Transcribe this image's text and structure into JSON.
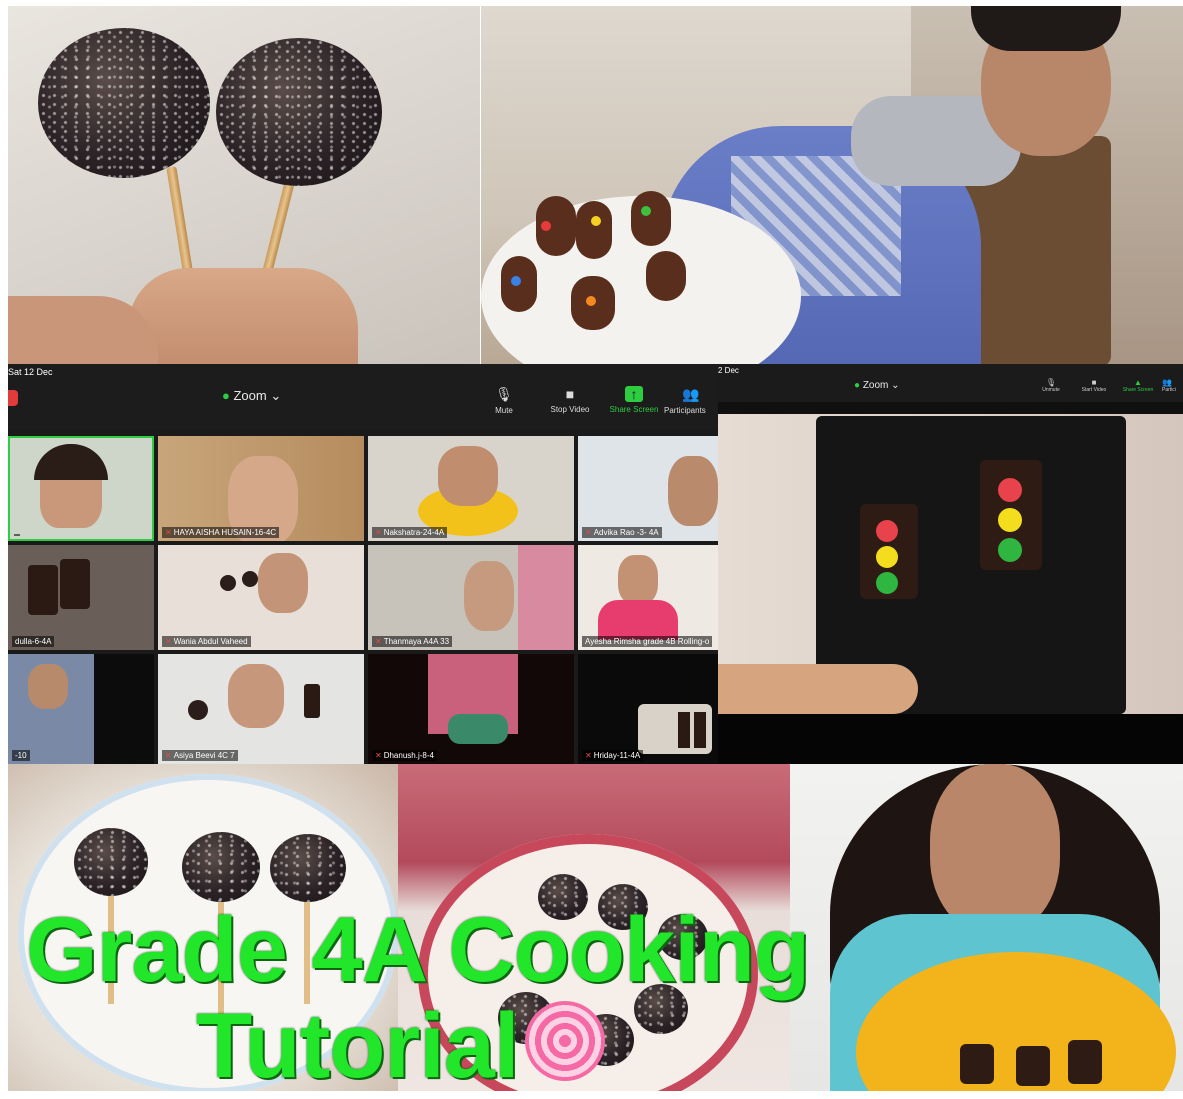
{
  "caption": {
    "line1": "Grade 4A Cooking",
    "line2": "Tutorial",
    "emoji": "lollipop"
  },
  "zoom_main": {
    "date": "Sat 12 Dec",
    "app_title": "Zoom",
    "controls": [
      {
        "label": "Mute",
        "icon": "mic-icon"
      },
      {
        "label": "Stop Video",
        "icon": "video-icon"
      },
      {
        "label": "Share Screen",
        "icon": "share-screen-icon"
      },
      {
        "label": "Participants",
        "icon": "participants-icon"
      }
    ],
    "tiles": [
      {
        "name": ""
      },
      {
        "name": "HAYA AISHA HUSAIN-16-4C"
      },
      {
        "name": "Nakshatra-24-4A"
      },
      {
        "name": "Advika Rao -3- 4A"
      },
      {
        "name": "dulla-6-4A"
      },
      {
        "name": "Wania Abdul Vaheed"
      },
      {
        "name": "Thanmaya A4A 33"
      },
      {
        "name": "Ayesha Rimsha grade 4B Rolling-o"
      },
      {
        "name": "-10"
      },
      {
        "name": "Asiya Beevi 4C 7"
      },
      {
        "name": "Dhanush.j-8-4"
      },
      {
        "name": "Hriday-11-4A"
      }
    ]
  },
  "zoom_shared": {
    "date": "2 Dec",
    "app_title": "Zoom",
    "controls": [
      "Unmute",
      "Start Video",
      "Share Screen",
      "Partici"
    ]
  },
  "colors": {
    "caption_green": "#22e62a",
    "zoom_bar": "#1c1c1c",
    "zoom_green": "#2ecc40",
    "mic_red": "#e24a4a"
  }
}
